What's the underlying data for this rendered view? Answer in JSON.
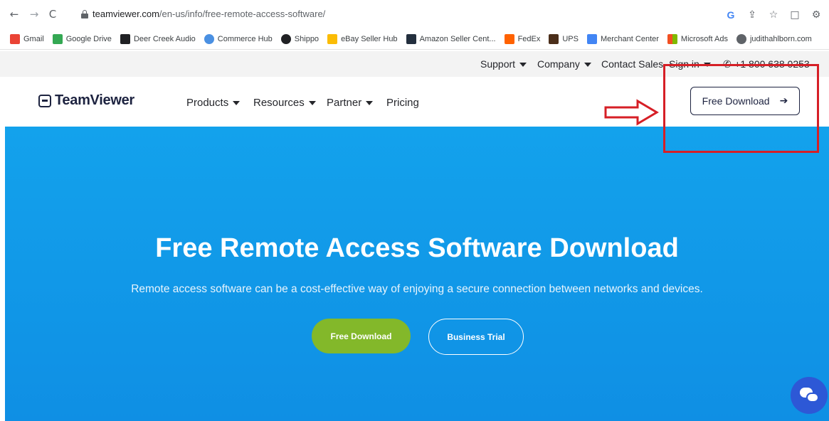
{
  "browser": {
    "back_icon": "back-arrow-icon",
    "forward_icon": "forward-arrow-icon",
    "reload_icon": "reload-icon",
    "url_domain": "teamviewer.com",
    "url_path": "/en-us/info/free-remote-access-software/",
    "google_icon_label": "G",
    "bookmarks": [
      {
        "label": "Gmail",
        "color": "#ea4335"
      },
      {
        "label": "Google Drive",
        "color": "#34a853"
      },
      {
        "label": "Deer Creek Audio",
        "color": "#202124"
      },
      {
        "label": "Commerce Hub",
        "color": "#4a90e2"
      },
      {
        "label": "Shippo",
        "color": "#202124"
      },
      {
        "label": "eBay Seller Hub",
        "color": "#fbbc05"
      },
      {
        "label": "Amazon Seller Cent...",
        "color": "#232f3e"
      },
      {
        "label": "FedEx",
        "color": "#ff6200"
      },
      {
        "label": "UPS",
        "color": "#4b2e1a"
      },
      {
        "label": "Merchant Center",
        "color": "#4285f4"
      },
      {
        "label": "Microsoft Ads",
        "color": "#f25022"
      },
      {
        "label": "judithahlborn.com",
        "color": "#5f6368"
      }
    ]
  },
  "topbar": {
    "support": "Support",
    "company": "Company",
    "contact_sales": "Contact Sales",
    "sign_in": "Sign in",
    "phone": "+1 800 638 0253"
  },
  "header": {
    "logo_text": "TeamViewer",
    "nav": {
      "products": "Products",
      "resources": "Resources",
      "partner": "Partner",
      "pricing": "Pricing"
    },
    "free_download": "Free Download"
  },
  "hero": {
    "title": "Free Remote Access Software Download",
    "subtitle": "Remote access software can be a cost-effective way of enjoying a secure connection between networks and devices.",
    "primary_button": "Free Download",
    "secondary_button": "Business Trial",
    "bg_color": "#13a2ec",
    "green_color": "#83b82a"
  },
  "annotation": {
    "color": "#d61f26"
  }
}
